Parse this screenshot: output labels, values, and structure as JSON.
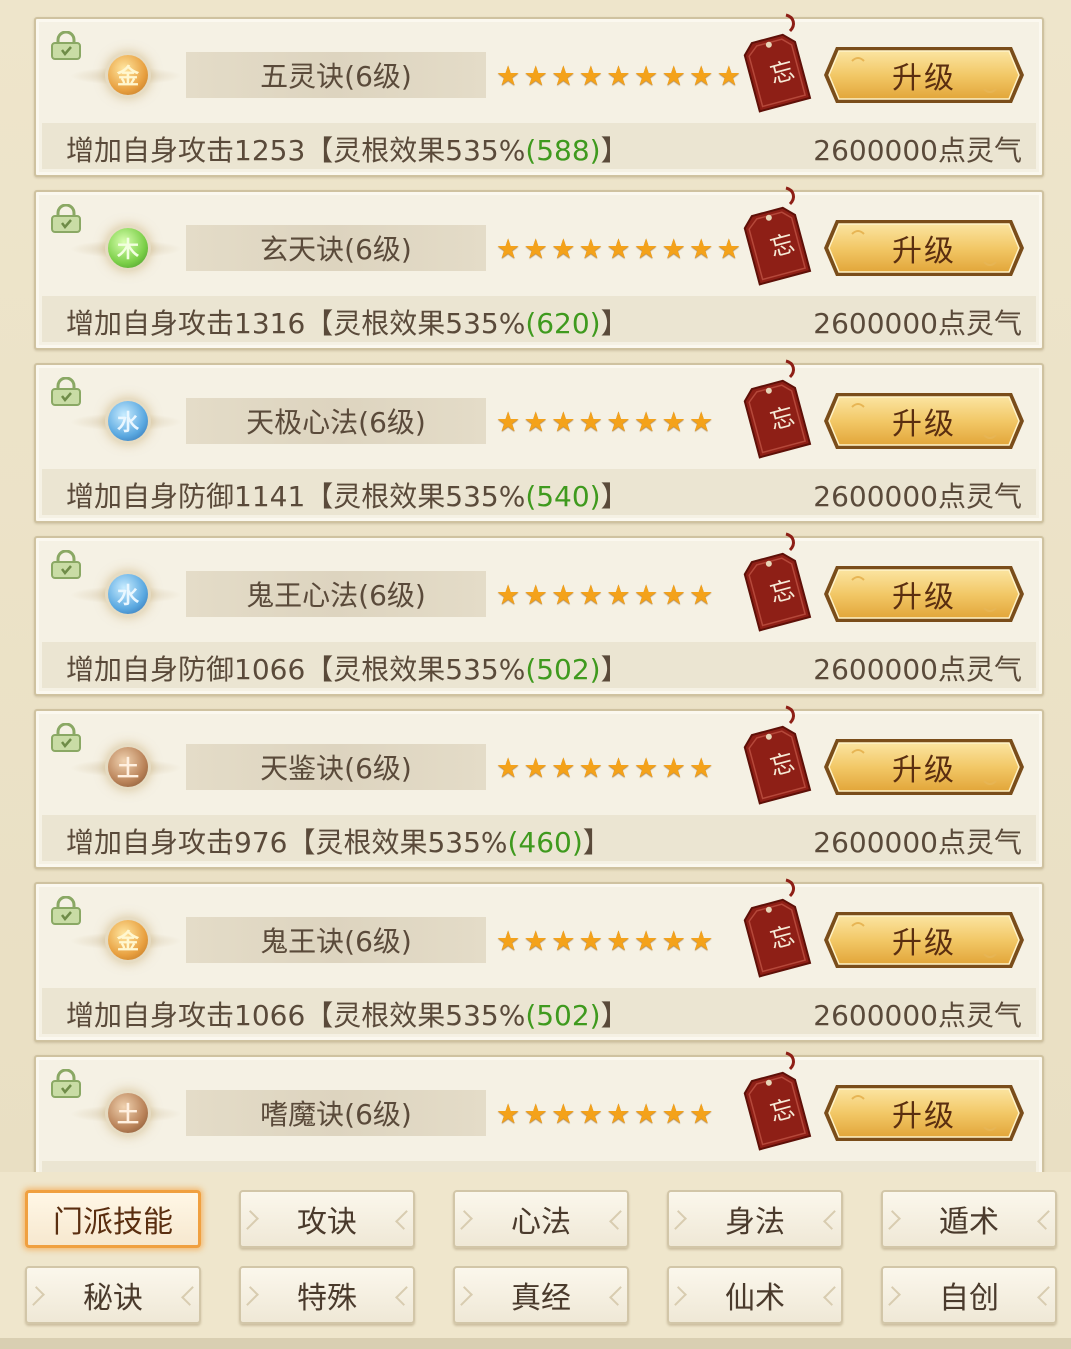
{
  "skills": [
    {
      "element": "金",
      "element_type": "gold",
      "name": "五灵诀(6级)",
      "stars": 9,
      "desc_prefix": "增加自身攻击1253【灵根效果535%",
      "desc_bonus": "(588)",
      "desc_suffix": "】",
      "cost": "2600000点灵气",
      "forget_label": "忘",
      "upgrade_label": "升级"
    },
    {
      "element": "木",
      "element_type": "wood",
      "name": "玄天诀(6级)",
      "stars": 9,
      "desc_prefix": "增加自身攻击1316【灵根效果535%",
      "desc_bonus": "(620)",
      "desc_suffix": "】",
      "cost": "2600000点灵气",
      "forget_label": "忘",
      "upgrade_label": "升级"
    },
    {
      "element": "水",
      "element_type": "water",
      "name": "天极心法(6级)",
      "stars": 8,
      "desc_prefix": "增加自身防御1141【灵根效果535%",
      "desc_bonus": "(540)",
      "desc_suffix": "】",
      "cost": "2600000点灵气",
      "forget_label": "忘",
      "upgrade_label": "升级"
    },
    {
      "element": "水",
      "element_type": "water",
      "name": "鬼王心法(6级)",
      "stars": 8,
      "desc_prefix": "增加自身防御1066【灵根效果535%",
      "desc_bonus": "(502)",
      "desc_suffix": "】",
      "cost": "2600000点灵气",
      "forget_label": "忘",
      "upgrade_label": "升级"
    },
    {
      "element": "土",
      "element_type": "earth",
      "name": "天鉴诀(6级)",
      "stars": 8,
      "desc_prefix": "增加自身攻击976【灵根效果535%",
      "desc_bonus": "(460)",
      "desc_suffix": "】",
      "cost": "2600000点灵气",
      "forget_label": "忘",
      "upgrade_label": "升级"
    },
    {
      "element": "金",
      "element_type": "gold",
      "name": "鬼王诀(6级)",
      "stars": 8,
      "desc_prefix": "增加自身攻击1066【灵根效果535%",
      "desc_bonus": "(502)",
      "desc_suffix": "】",
      "cost": "2600000点灵气",
      "forget_label": "忘",
      "upgrade_label": "升级"
    },
    {
      "element": "土",
      "element_type": "earth",
      "name": "嗜魔诀(6级)",
      "stars": 8,
      "desc_prefix": "",
      "desc_bonus": "",
      "desc_suffix": "",
      "cost": "",
      "forget_label": "忘",
      "upgrade_label": "升级"
    }
  ],
  "tabs": [
    {
      "label": "门派技能",
      "active": true
    },
    {
      "label": "攻诀",
      "active": false
    },
    {
      "label": "心法",
      "active": false
    },
    {
      "label": "身法",
      "active": false
    },
    {
      "label": "遁术",
      "active": false
    },
    {
      "label": "秘诀",
      "active": false
    },
    {
      "label": "特殊",
      "active": false
    },
    {
      "label": "真经",
      "active": false
    },
    {
      "label": "仙术",
      "active": false
    },
    {
      "label": "自创",
      "active": false
    }
  ],
  "icons": {
    "lock": "lock-icon",
    "star": "star-icon",
    "forget": "forget-tag-icon"
  },
  "colors": {
    "bonus_green": "#3f9a1e",
    "star": "#f4a21a",
    "tab_active_border": "#f0a040",
    "forget_tag": "#8e1f16",
    "upgrade_gold": "#f2c867"
  }
}
